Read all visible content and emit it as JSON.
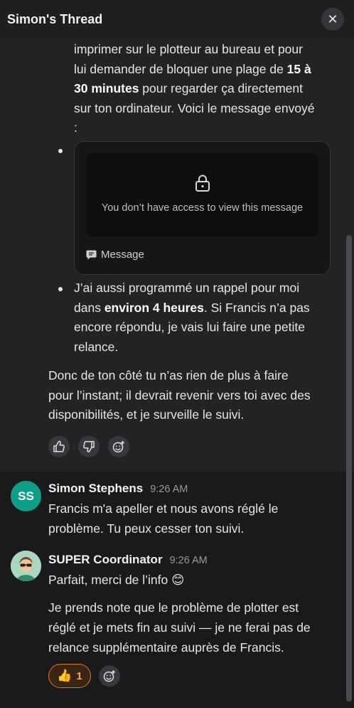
{
  "header": {
    "title": "Simon's Thread",
    "close_glyph": "✕"
  },
  "bot_reply": {
    "bullet1_lines": [
      "imprimer sur le plotteur au bureau et pour",
      "lui demander de bloquer une plage de ",
      "15 à",
      "30 minutes",
      " pour regarder ça directement",
      "sur ton ordinateur. Voici le message envoyé",
      ":"
    ],
    "card": {
      "locked_text": "You don’t have access to view this message",
      "footer_label": "Message",
      "icon": "lock-icon"
    },
    "bullet3": {
      "t1": "J’ai aussi programmé un rappel pour moi",
      "t2a": "dans ",
      "t2b": "environ 4 heures",
      "t2c": ". Si Francis n’a pas",
      "t3": "encore répondu, je vais lui faire une petite",
      "t4": "relance."
    },
    "closing_lines": [
      "Donc de ton côté tu n’as rien de plus à faire",
      "pour l’instant; il devrait revenir vers toi avec des",
      "disponibilités, et je surveille le suivi."
    ]
  },
  "messages": [
    {
      "avatar_initials": "SS",
      "name": "Simon Stephens",
      "time": "9:26 AM",
      "lines": [
        "Francis m'a apeller et nous avons réglé le",
        "problème. Tu peux cesser ton suivi."
      ]
    },
    {
      "name": "SUPER Coordinator",
      "time": "9:26 AM",
      "line1": "Parfait, merci de l’info ",
      "emoji": "😊",
      "lines": [
        "Je prends note que le problème de plotter est",
        "réglé et je mets fin au suivi — je ne ferai pas de",
        "relance supplémentaire auprès de Francis."
      ],
      "reaction": {
        "emoji": "👍",
        "count": "1"
      }
    }
  ],
  "colors": {
    "accent_reaction": "#d87a2a",
    "avatar_ss": "#0f9e87"
  }
}
